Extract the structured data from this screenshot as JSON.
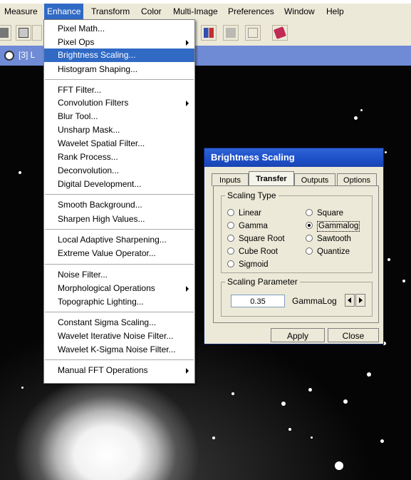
{
  "menubar": {
    "items": [
      "Measure",
      "Enhance",
      "Transform",
      "Color",
      "Multi-Image",
      "Preferences",
      "Window",
      "Help"
    ],
    "active": "Enhance"
  },
  "image_window": {
    "title": "[3] L"
  },
  "enhance_menu": {
    "items": [
      {
        "label": "Pixel Math...",
        "submenu": false
      },
      {
        "label": "Pixel Ops",
        "submenu": true
      },
      {
        "label": "Brightness Scaling...",
        "submenu": false,
        "highlighted": true
      },
      {
        "label": "Histogram Shaping...",
        "submenu": false
      },
      {
        "label": "FFT Filter...",
        "submenu": false
      },
      {
        "label": "Convolution Filters",
        "submenu": true
      },
      {
        "label": "Blur Tool...",
        "submenu": false
      },
      {
        "label": "Unsharp Mask...",
        "submenu": false
      },
      {
        "label": "Wavelet Spatial Filter...",
        "submenu": false
      },
      {
        "label": "Rank Process...",
        "submenu": false
      },
      {
        "label": "Deconvolution...",
        "submenu": false
      },
      {
        "label": "Digital Development...",
        "submenu": false
      },
      {
        "label": "Smooth Background...",
        "submenu": false
      },
      {
        "label": "Sharpen High Values...",
        "submenu": false
      },
      {
        "label": "Local Adaptive Sharpening...",
        "submenu": false
      },
      {
        "label": "Extreme Value Operator...",
        "submenu": false
      },
      {
        "label": "Noise Filter...",
        "submenu": false
      },
      {
        "label": "Morphological Operations",
        "submenu": true
      },
      {
        "label": "Topographic Lighting...",
        "submenu": false
      },
      {
        "label": "Constant Sigma Scaling...",
        "submenu": false
      },
      {
        "label": "Wavelet Iterative Noise Filter...",
        "submenu": false
      },
      {
        "label": "Wavelet K-Sigma Noise Filter...",
        "submenu": false
      },
      {
        "label": "Manual FFT Operations",
        "submenu": true
      }
    ]
  },
  "dialog": {
    "title": "Brightness Scaling",
    "tabs": [
      "Inputs",
      "Transfer",
      "Outputs",
      "Options"
    ],
    "selected_tab": "Transfer",
    "scaling_type": {
      "legend": "Scaling Type",
      "options": [
        "Linear",
        "Gamma",
        "Square Root",
        "Cube Root",
        "Sigmoid",
        "Square",
        "Gammalog",
        "Sawtooth",
        "Quantize"
      ],
      "selected": "Gammalog"
    },
    "scaling_parameter": {
      "legend": "Scaling Parameter",
      "value": "0.35",
      "label": "GammaLog"
    },
    "buttons": {
      "apply": "Apply",
      "close": "Close"
    }
  },
  "colors": {
    "menu_highlight": "#316ac5",
    "dialog_title": "#1d4fc7",
    "window_face": "#ece9d8"
  }
}
